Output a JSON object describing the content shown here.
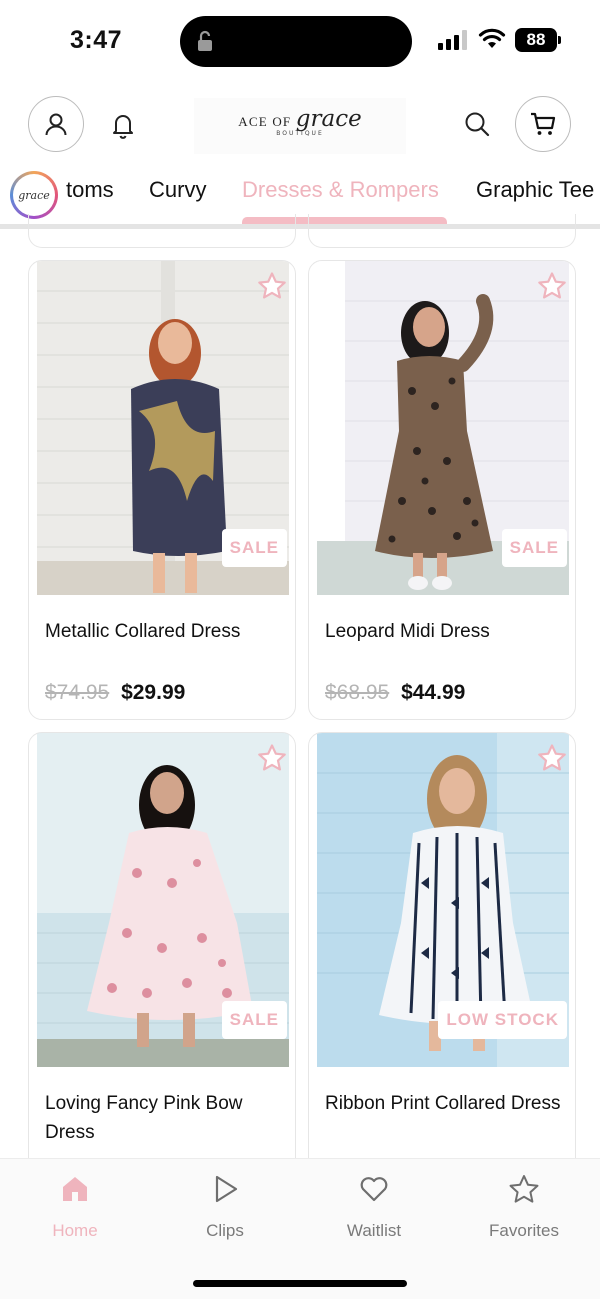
{
  "status_bar": {
    "time": "3:47",
    "battery": "88"
  },
  "header": {
    "logo_text_1": "ACE OF",
    "logo_text_2": "grace",
    "logo_sub": "BOUTIQUE"
  },
  "tab_logo_text": "grace",
  "tabs": [
    {
      "label": "toms"
    },
    {
      "label": "Curvy"
    },
    {
      "label": "Dresses & Rompers",
      "active": true
    },
    {
      "label": "Graphic Tee"
    }
  ],
  "colors": {
    "accent_pink": "#efb4bd",
    "underline_pink": "#f4bcc4",
    "text": "#111111",
    "muted": "#7a7a7a"
  },
  "products": [
    {
      "name": "Metallic Collared Dress",
      "old_price": "$74.95",
      "price": "$29.99",
      "badge": "SALE"
    },
    {
      "name": "Leopard Midi Dress",
      "old_price": "$68.95",
      "price": "$44.99",
      "badge": "SALE"
    },
    {
      "name": "Loving Fancy Pink Bow Dress",
      "badge": "SALE"
    },
    {
      "name": "Ribbon Print Collared Dress",
      "badge": "LOW STOCK"
    }
  ],
  "bottom_nav": [
    {
      "label": "Home",
      "icon": "home-icon",
      "active": true
    },
    {
      "label": "Clips",
      "icon": "play-icon"
    },
    {
      "label": "Waitlist",
      "icon": "heart-icon"
    },
    {
      "label": "Favorites",
      "icon": "star-icon"
    }
  ]
}
